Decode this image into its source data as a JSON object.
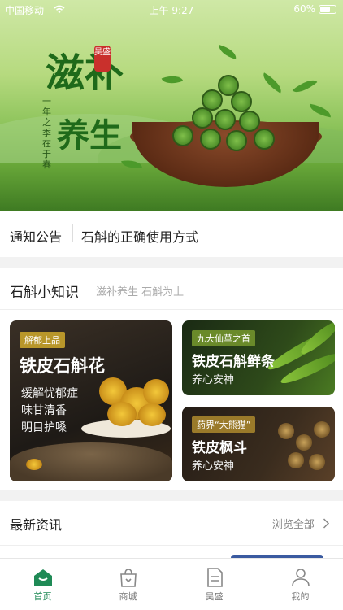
{
  "status_bar": {
    "carrier": "中国移动",
    "time": "上午 9:27",
    "battery": "60%"
  },
  "banner": {
    "brand_seal": "昊盛",
    "slogan_line1": "滋补",
    "slogan_line2": "养生",
    "slogan_small": "一年之季在于春"
  },
  "notice": {
    "label": "通知公告",
    "text": "石斛的正确使用方式"
  },
  "knowledge": {
    "title": "石斛小知识",
    "subtitle": "滋补养生 石斛为上",
    "cards": [
      {
        "tag": "解郁上品",
        "name": "铁皮石斛花",
        "desc_lines": [
          "缓解忧郁症",
          "味甘清香",
          "明目护嗓"
        ]
      },
      {
        "tag": "九大仙草之首",
        "name": "铁皮石斛鲜条",
        "desc": "养心安神"
      },
      {
        "tag": "药界“大熊猫”",
        "name": "铁皮枫斗",
        "desc": "养心安神"
      }
    ]
  },
  "news": {
    "title": "最新资讯",
    "more": "浏览全部"
  },
  "tabbar": {
    "active_color": "#1f8a56",
    "items": [
      {
        "label": "首页",
        "icon": "home-icon"
      },
      {
        "label": "商城",
        "icon": "shopping-bag-icon"
      },
      {
        "label": "昊盛",
        "icon": "document-icon"
      },
      {
        "label": "我的",
        "icon": "person-icon"
      }
    ]
  }
}
